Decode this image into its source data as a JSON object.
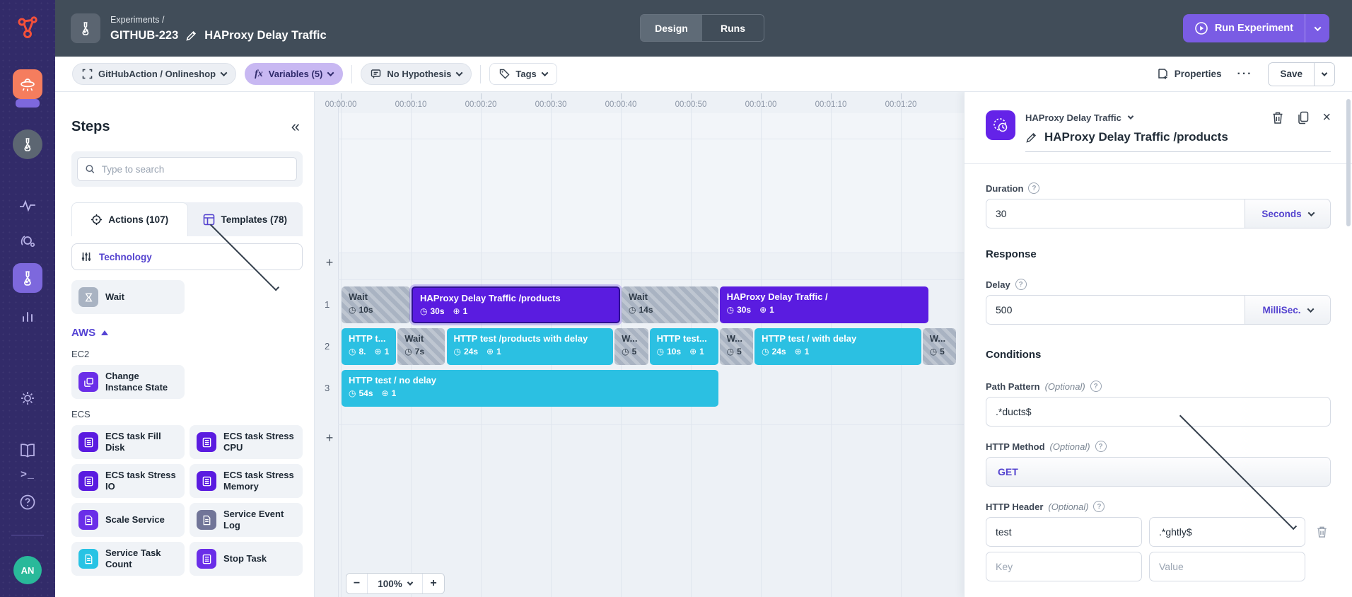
{
  "sidebar": {
    "avatar": "AN"
  },
  "header": {
    "breadcrumb": "Experiments /",
    "experiment_id": "GITHUB-223",
    "experiment_name": "HAProxy Delay Traffic",
    "tab_design": "Design",
    "tab_runs": "Runs",
    "run_button": "Run Experiment"
  },
  "toolbar": {
    "environment": "GitHubAction / Onlineshop",
    "variables": "Variables (5)",
    "hypothesis": "No Hypothesis",
    "tags": "Tags",
    "properties": "Properties",
    "more": "···",
    "save": "Save"
  },
  "steps": {
    "title": "Steps",
    "collapse": "«",
    "search_placeholder": "Type to search",
    "actions_tab": "Actions (107)",
    "templates_tab": "Templates (78)",
    "filter_label": "Technology",
    "wait_item": {
      "label": "Wait",
      "color": "#a9b3c2",
      "icon": "hourglass-icon"
    },
    "aws_header": "AWS",
    "groups": [
      {
        "name": "EC2",
        "items": [
          {
            "label": "Change Instance State",
            "color": "#6a2ee8",
            "icon": "instance-icon"
          }
        ]
      },
      {
        "name": "ECS",
        "items": [
          {
            "label": "ECS task Fill Disk",
            "color": "#5a1be0",
            "icon": "task-icon"
          },
          {
            "label": "ECS task Stress CPU",
            "color": "#5a1be0",
            "icon": "task-icon"
          },
          {
            "label": "ECS task Stress IO",
            "color": "#5a1be0",
            "icon": "task-icon"
          },
          {
            "label": "ECS task Stress Memory",
            "color": "#5a1be0",
            "icon": "task-icon"
          },
          {
            "label": "Scale Service",
            "color": "#6a2ee8",
            "icon": "doc-icon"
          },
          {
            "label": "Service Event Log",
            "color": "#717598",
            "icon": "doc-icon"
          },
          {
            "label": "Service Task Count",
            "color": "#27c3e4",
            "icon": "doc-icon"
          },
          {
            "label": "Stop Task",
            "color": "#6a2ee8",
            "icon": "task-icon"
          }
        ]
      }
    ]
  },
  "timeline": {
    "ruler": [
      "00:00:00",
      "00:00:10",
      "00:00:20",
      "00:00:30",
      "00:00:40",
      "00:00:50",
      "00:01:00",
      "00:01:10",
      "00:01:20"
    ],
    "zoom_level": "100%",
    "lanes": [
      {
        "row": "1",
        "blocks": [
          {
            "kind": "wait",
            "label": "Wait",
            "duration": "10s",
            "secs": 10
          },
          {
            "kind": "attack",
            "label": "HAProxy Delay Traffic /products",
            "duration": "30s",
            "targets": "1",
            "secs": 30,
            "selected": true
          },
          {
            "kind": "wait",
            "label": "Wait",
            "duration": "14s",
            "secs": 14
          },
          {
            "kind": "attack",
            "label": "HAProxy Delay Traffic /",
            "duration": "30s",
            "targets": "1",
            "secs": 30
          }
        ]
      },
      {
        "row": "2",
        "blocks": [
          {
            "kind": "http",
            "label": "HTTP t...",
            "duration": "8.",
            "targets": "1",
            "secs": 8
          },
          {
            "kind": "wait",
            "label": "Wait",
            "duration": "7s",
            "secs": 7
          },
          {
            "kind": "http",
            "label": "HTTP test /products with delay",
            "duration": "24s",
            "targets": "1",
            "secs": 24
          },
          {
            "kind": "wait",
            "label": "W...",
            "duration": "5",
            "secs": 5
          },
          {
            "kind": "http",
            "label": "HTTP test...",
            "duration": "10s",
            "targets": "1",
            "secs": 10
          },
          {
            "kind": "wait",
            "label": "W...",
            "duration": "5",
            "secs": 5
          },
          {
            "kind": "http",
            "label": "HTTP test / with delay",
            "duration": "24s",
            "targets": "1",
            "secs": 24
          },
          {
            "kind": "wait",
            "label": "W...",
            "duration": "5",
            "secs": 5
          }
        ]
      },
      {
        "row": "3",
        "blocks": [
          {
            "kind": "http",
            "label": "HTTP test / no delay",
            "duration": "54s",
            "targets": "1",
            "secs": 54
          }
        ]
      }
    ]
  },
  "config": {
    "action_type": "HAProxy Delay Traffic",
    "title": "HAProxy Delay Traffic /products",
    "duration_label": "Duration",
    "duration_value": "30",
    "duration_unit": "Seconds",
    "response_heading": "Response",
    "delay_label": "Delay",
    "delay_value": "500",
    "delay_unit": "MilliSec.",
    "conditions_heading": "Conditions",
    "optional": "(Optional)",
    "path_label": "Path Pattern",
    "path_value": ".*ducts$",
    "method_label": "HTTP Method",
    "method_value": "GET",
    "header_label": "HTTP Header",
    "header_key": "test",
    "header_value": ".*ghtly$",
    "key_placeholder": "Key",
    "value_placeholder": "Value"
  },
  "colors": {
    "accent": "#7a5ce4",
    "attack": "#5a1ce0",
    "http": "#2bc0e2",
    "wait": "#a9b3c2"
  }
}
